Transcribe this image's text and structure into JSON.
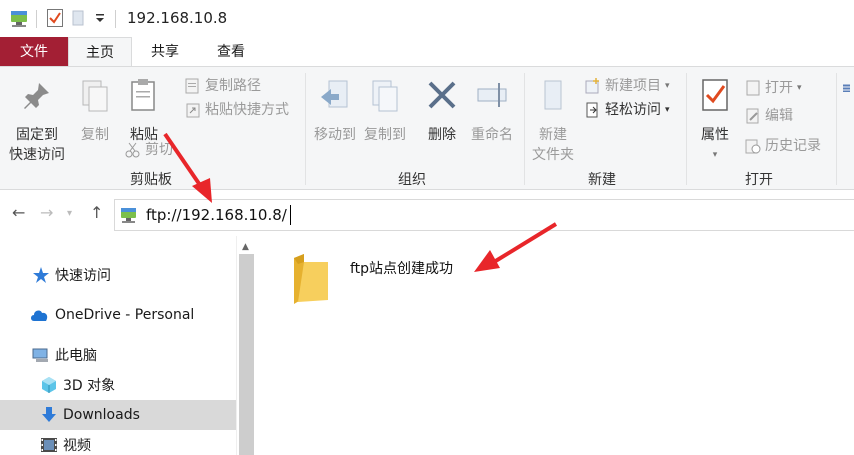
{
  "window": {
    "title": "192.168.10.8"
  },
  "tabs": [
    {
      "label": "文件"
    },
    {
      "label": "主页"
    },
    {
      "label": "共享"
    },
    {
      "label": "查看"
    }
  ],
  "ribbon": {
    "clipboard": {
      "pin_label_1": "固定到",
      "pin_label_2": "快速访问",
      "copy_label": "复制",
      "paste_label": "粘贴",
      "copy_path_label": "复制路径",
      "paste_shortcut_label": "粘贴快捷方式",
      "cut_label": "剪切",
      "group_label": "剪贴板"
    },
    "organize": {
      "move_to_label": "移动到",
      "copy_to_label": "复制到",
      "delete_label": "删除",
      "rename_label": "重命名",
      "group_label": "组织"
    },
    "new": {
      "new_folder_label_1": "新建",
      "new_folder_label_2": "文件夹",
      "new_item_label": "新建项目",
      "easy_access_label": "轻松访问",
      "group_label": "新建"
    },
    "open": {
      "properties_label": "属性",
      "open_label": "打开",
      "edit_label": "编辑",
      "history_label": "历史记录",
      "group_label": "打开"
    }
  },
  "address_bar": {
    "value": "ftp://192.168.10.8/"
  },
  "nav_pane": {
    "items": [
      {
        "label": "快速访问"
      },
      {
        "label": "OneDrive - Personal"
      },
      {
        "label": "此电脑"
      },
      {
        "label": "3D 对象"
      },
      {
        "label": "Downloads"
      },
      {
        "label": "视频"
      }
    ]
  },
  "content": {
    "items": [
      {
        "name": "ftp站点创建成功"
      }
    ]
  },
  "colors": {
    "file_tab": "#a31f34",
    "folder": "#f5c542",
    "arrow": "#e8262a",
    "selected_nav": "#d9d9d9"
  }
}
